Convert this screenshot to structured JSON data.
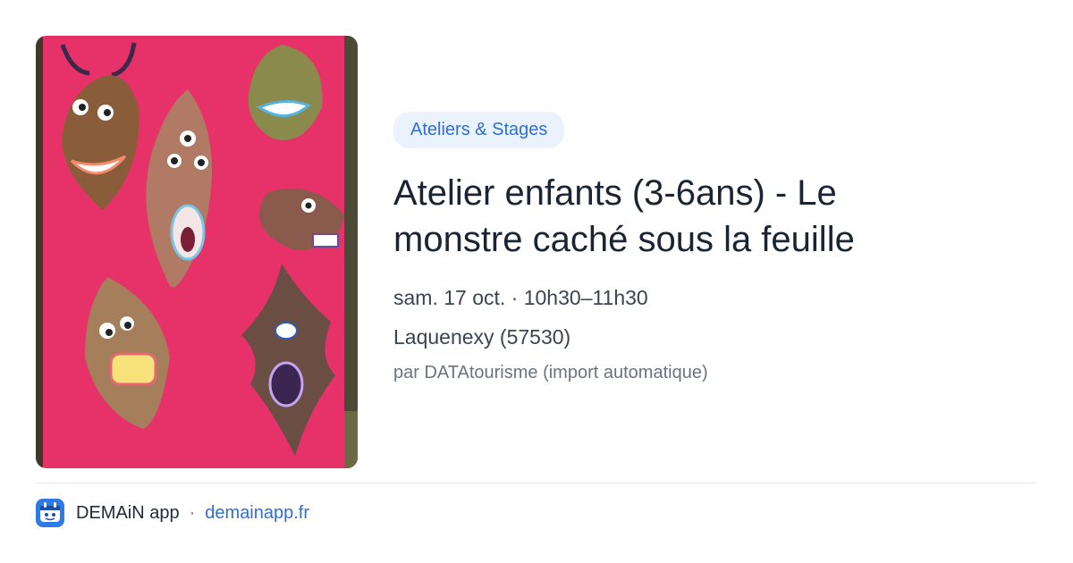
{
  "card": {
    "image": {
      "description_icon": "leaf-monsters-photo",
      "background_color": "#e63268"
    },
    "category_label": "Ateliers & Stages",
    "title": "Atelier enfants (3-6ans) - Le monstre caché sous la feuille",
    "date_time": "sam. 17 oct. · 10h30–11h30",
    "location": "Laquenexy (57530)",
    "source": "par DATAtourisme (import automatique)"
  },
  "footer": {
    "app_icon": "demain-app-icon",
    "app_name": "DEMAiN app",
    "separator": "·",
    "domain": "demainapp.fr"
  },
  "colors": {
    "accent": "#2f6fd1",
    "badge_background": "#eaf2fd",
    "app_icon_background": "#2f7be5"
  }
}
